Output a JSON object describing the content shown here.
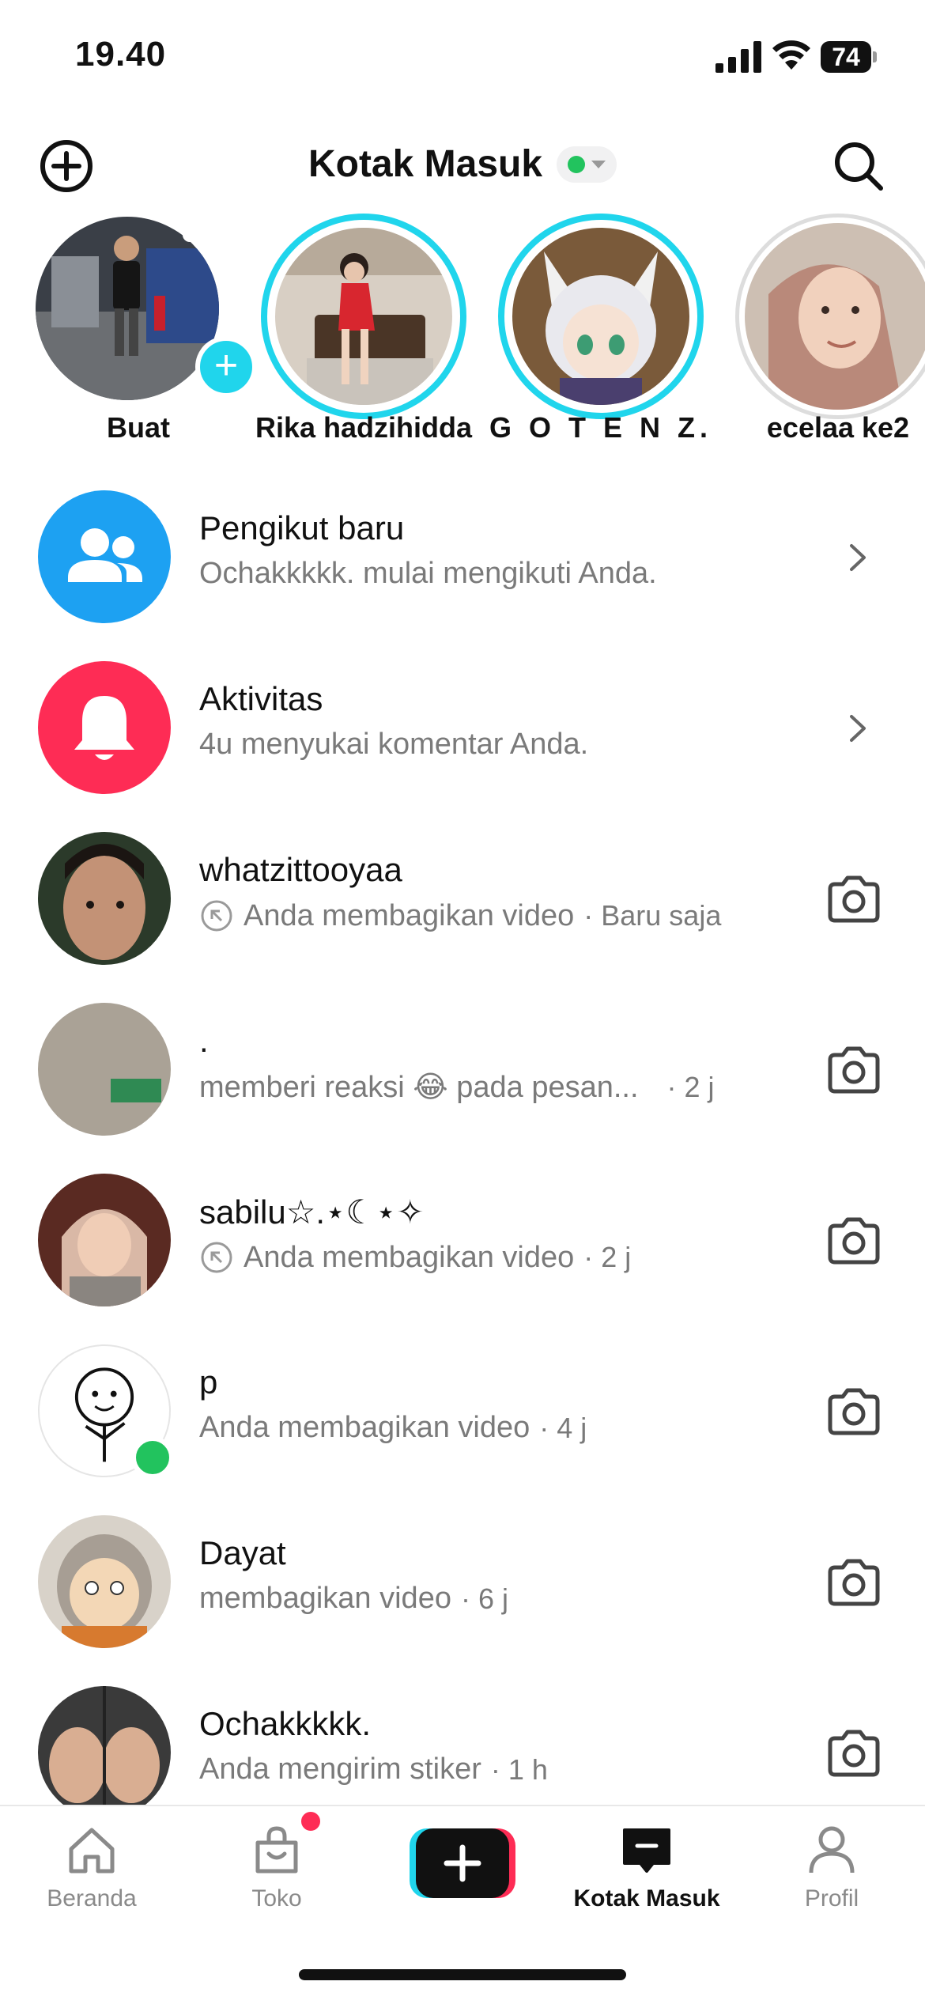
{
  "status_bar": {
    "time": "19.40",
    "battery": "74"
  },
  "header": {
    "title": "Kotak Masuk",
    "status_color": "#22c35e"
  },
  "stories": [
    {
      "label": "Buat"
    },
    {
      "label": "Rika hadzihidda"
    },
    {
      "label": "G O T E N Z."
    },
    {
      "label": "ecelaa ke2"
    }
  ],
  "activity_rows": [
    {
      "title": "Pengikut baru",
      "subtitle": "Ochakkkkk. mulai mengikuti Anda.",
      "icon": "followers-icon",
      "color": "#1da1f2"
    },
    {
      "title": "Aktivitas",
      "subtitle": "4u menyukai komentar Anda.",
      "icon": "bell-icon",
      "color": "#fe2c55"
    }
  ],
  "messages": [
    {
      "name": "whatzittooyaa",
      "preview": "Anda membagikan video",
      "time": "· Baru saja",
      "shared_icon": true
    },
    {
      "name": ".",
      "preview": "memberi reaksi 😂 pada pesan...",
      "time": "· 2 j",
      "shared_icon": false
    },
    {
      "name": "sabilu☆.⋆☾⋆✧",
      "preview": "Anda membagikan video",
      "time": "· 2 j",
      "shared_icon": true
    },
    {
      "name": "p",
      "preview": "Anda membagikan video",
      "time": "· 4 j",
      "shared_icon": false,
      "online": true
    },
    {
      "name": "Dayat",
      "preview": "membagikan video",
      "time": "· 6 j",
      "shared_icon": false
    },
    {
      "name": "Ochakkkkk.",
      "preview": "Anda mengirim stiker",
      "time": "· 1 h",
      "shared_icon": false
    }
  ],
  "tabbar": {
    "home": "Beranda",
    "shop": "Toko",
    "inbox": "Kotak Masuk",
    "profile": "Profil"
  },
  "colors": {
    "accent_cyan": "#20d5ec",
    "accent_red": "#fe2c55",
    "online_green": "#22c35e"
  }
}
